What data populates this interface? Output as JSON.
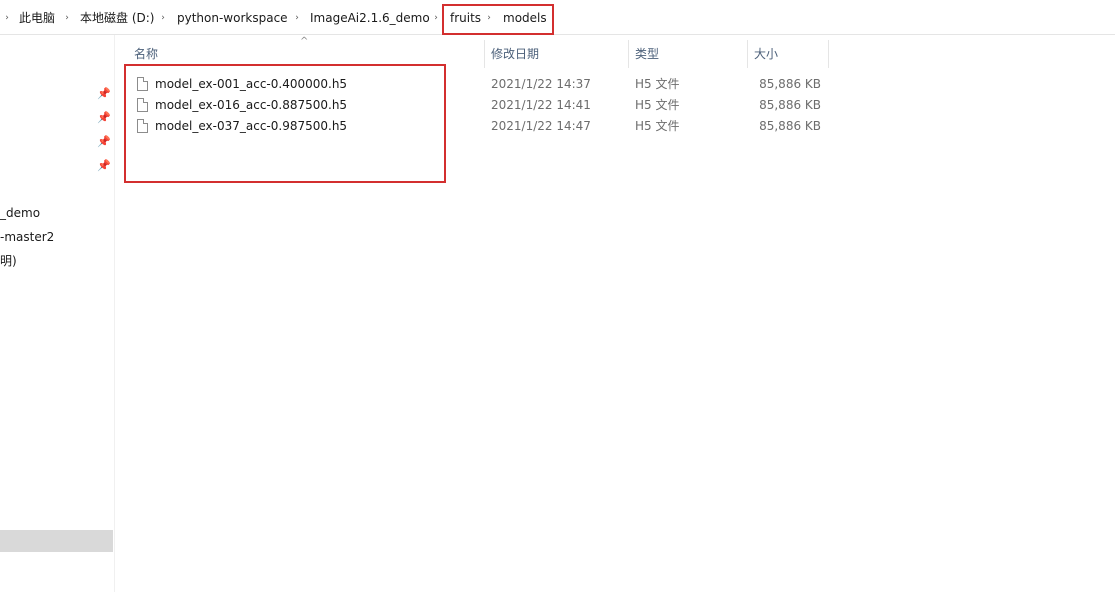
{
  "breadcrumb": {
    "items": [
      "此电脑",
      "本地磁盘 (D:)",
      "python-workspace",
      "ImageAi2.1.6_demo",
      "fruits",
      "models"
    ]
  },
  "nav": {
    "labels": [
      "_demo",
      "-master2",
      "明)"
    ]
  },
  "columns": {
    "name": "名称",
    "modified": "修改日期",
    "type": "类型",
    "size": "大小"
  },
  "files": [
    {
      "name": "model_ex-001_acc-0.400000.h5",
      "modified": "2021/1/22 14:37",
      "type": "H5 文件",
      "size": "85,886 KB"
    },
    {
      "name": "model_ex-016_acc-0.887500.h5",
      "modified": "2021/1/22 14:41",
      "type": "H5 文件",
      "size": "85,886 KB"
    },
    {
      "name": "model_ex-037_acc-0.987500.h5",
      "modified": "2021/1/22 14:47",
      "type": "H5 文件",
      "size": "85,886 KB"
    }
  ],
  "colors": {
    "highlight": "#d32f2f",
    "header_text": "#4c607a"
  }
}
